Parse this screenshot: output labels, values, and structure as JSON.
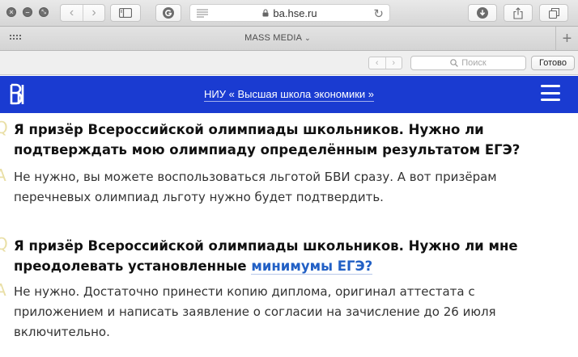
{
  "browser": {
    "url": "ba.hse.ru",
    "tab_title": "MASS MEDIA",
    "find_placeholder": "Поиск",
    "done_label": "Готово"
  },
  "site": {
    "title": "НИУ « Высшая школа экономики »",
    "brand_color": "#1a3bd1"
  },
  "faq": [
    {
      "question": "Я призёр Всероссийской олимпиады школьников. Нужно ли подтверждать мою олимпиаду определённым результатом ЕГЭ?",
      "answer": "Не нужно, вы можете воспользоваться льготой БВИ сразу. А вот призёрам перечневых олимпиад льготу нужно будет подтвердить."
    },
    {
      "question_prefix": "Я призёр Всероссийской олимпиады школьников. Нужно ли мне преодолевать установленные",
      "question_link": "минимумы ЕГЭ?",
      "answer": "Не нужно. Достаточно принести копию диплома, оригинал аттестата с приложением и написать заявление о согласии на зачисление до 26 июля включительно."
    }
  ]
}
